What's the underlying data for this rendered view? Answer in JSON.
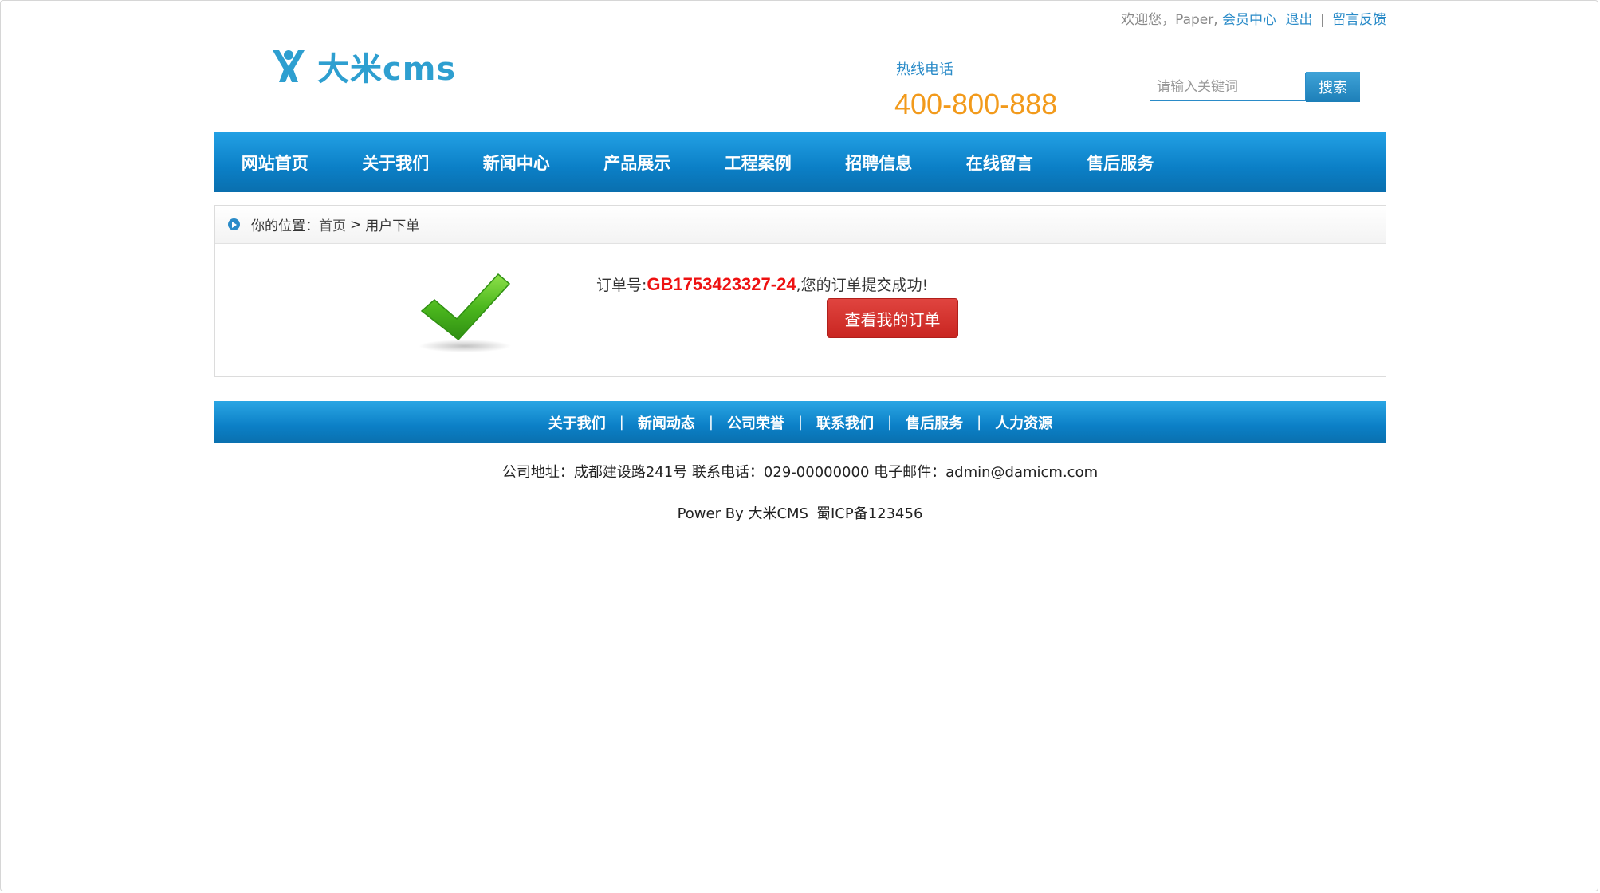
{
  "topbar": {
    "welcome": "欢迎您，Paper,",
    "member_center": "会员中心",
    "logout": "退出",
    "separator": "|",
    "feedback": "留言反馈"
  },
  "header": {
    "logo_text": "大米cms",
    "hotline_label": "热线电话",
    "hotline_number": "400-800-888",
    "search_placeholder": "请输入关键词",
    "search_button": "搜索"
  },
  "nav": {
    "items": [
      "网站首页",
      "关于我们",
      "新闻中心",
      "产品展示",
      "工程案例",
      "招聘信息",
      "在线留言",
      "售后服务"
    ]
  },
  "breadcrumb": {
    "label": "你的位置：",
    "home": "首页",
    "gt": ">",
    "current": "用户下单"
  },
  "order": {
    "prefix": "订单号:",
    "number": "GB1753423327-24",
    "suffix": ",您的订单提交成功!",
    "view_button": "查看我的订单"
  },
  "footer": {
    "links": [
      "关于我们",
      "新闻动态",
      "公司荣誉",
      "联系我们",
      "售后服务",
      "人力资源"
    ],
    "separator": "|",
    "info": "公司地址：成都建设路241号 联系电话：029-00000000 电子邮件：admin@damicm.com",
    "power": "Power By 大米CMS",
    "icp": "蜀ICP备123456"
  },
  "colors": {
    "brand_blue": "#0b7fc6",
    "link_blue": "#2a8bc8",
    "hotline_orange": "#f29a1b",
    "order_red": "#ee1111",
    "button_red": "#d4332e",
    "check_green": "#4cb81e"
  }
}
